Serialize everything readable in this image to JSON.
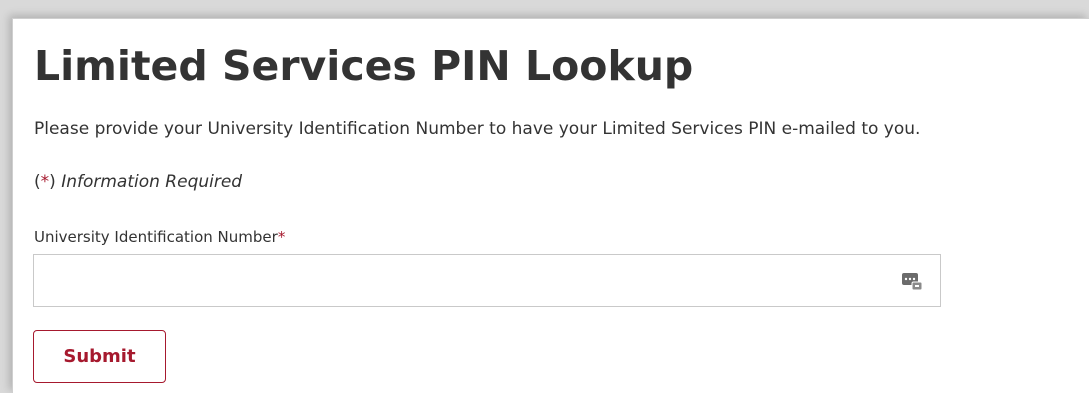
{
  "page": {
    "title": "Limited Services PIN Lookup",
    "intro": "Please provide your University Identification Number to have your Limited Services PIN e-mailed to you."
  },
  "required_note": {
    "open_paren": "(",
    "star": "*",
    "close_paren": ")",
    "text": "Information Required"
  },
  "form": {
    "uin_label": "University Identification Number",
    "uin_required_star": "*",
    "uin_value": "",
    "uin_placeholder": "",
    "uin_icon": "password-manager-key-icon",
    "submit_label": "Submit"
  },
  "colors": {
    "accent": "#a6192e",
    "text": "#333333",
    "border": "#c9c9c9"
  }
}
